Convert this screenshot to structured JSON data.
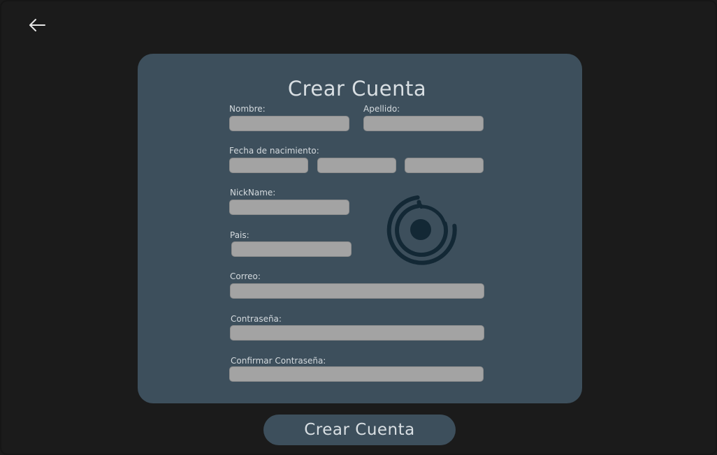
{
  "form": {
    "title": "Crear Cuenta",
    "labels": {
      "nombre": "Nombre:",
      "apellido": "Apellido:",
      "fecha_nacimiento": "Fecha de nacimiento:",
      "nickname": "NickName:",
      "pais": "Pais:",
      "correo": "Correo:",
      "contrasena": "Contraseña:",
      "confirmar_contrasena": "Confirmar Contraseña:"
    },
    "values": {
      "nombre": "",
      "apellido": "",
      "fecha_dia": "",
      "fecha_mes": "",
      "fecha_anio": "",
      "nickname": "",
      "pais": "",
      "correo": "",
      "contrasena": "",
      "confirmar_contrasena": ""
    }
  },
  "actions": {
    "back_icon": "arrow-left-icon",
    "submit_label": "Crear Cuenta"
  },
  "colors": {
    "background": "#1b1b1b",
    "card": "#3d4f5c",
    "field": "#a3a3a3",
    "logo": "#132835",
    "text": "#d9dfe3"
  }
}
